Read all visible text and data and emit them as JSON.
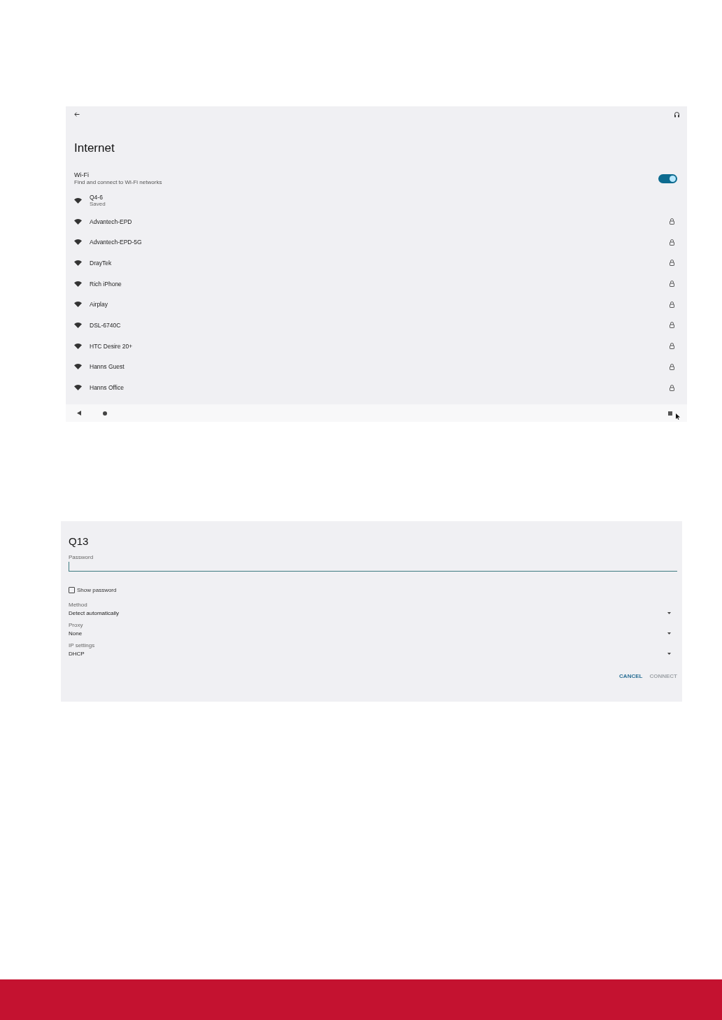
{
  "internet_screen": {
    "title": "Internet",
    "wifi": {
      "title": "Wi-Fi",
      "subtitle": "Find and connect to Wi-Fi networks",
      "on": true
    },
    "networks": [
      {
        "name": "Q4-6",
        "status": "Saved",
        "locked": false
      },
      {
        "name": "Advantech-EPD",
        "locked": true
      },
      {
        "name": "Advantech-EPD-5G",
        "locked": true
      },
      {
        "name": "DrayTek",
        "locked": true
      },
      {
        "name": "Rich iPhone",
        "locked": true
      },
      {
        "name": "Airplay",
        "locked": true
      },
      {
        "name": "DSL-6740C",
        "locked": true
      },
      {
        "name": "HTC Desire 20+",
        "locked": true
      },
      {
        "name": "Hanns Guest",
        "locked": true
      },
      {
        "name": "Hanns Office",
        "locked": true
      }
    ]
  },
  "connect_dialog": {
    "title": "Q13",
    "password": {
      "label": "Password",
      "focused": true
    },
    "show_password": {
      "label": "Show password",
      "checked": false
    },
    "dropdowns": [
      {
        "label": "Method",
        "value": "Detect automatically"
      },
      {
        "label": "Proxy",
        "value": "None"
      },
      {
        "label": "IP settings",
        "value": "DHCP"
      }
    ],
    "buttons": [
      {
        "label": "CANCEL",
        "disabled": false
      },
      {
        "label": "CONNECT",
        "disabled": true
      }
    ]
  }
}
